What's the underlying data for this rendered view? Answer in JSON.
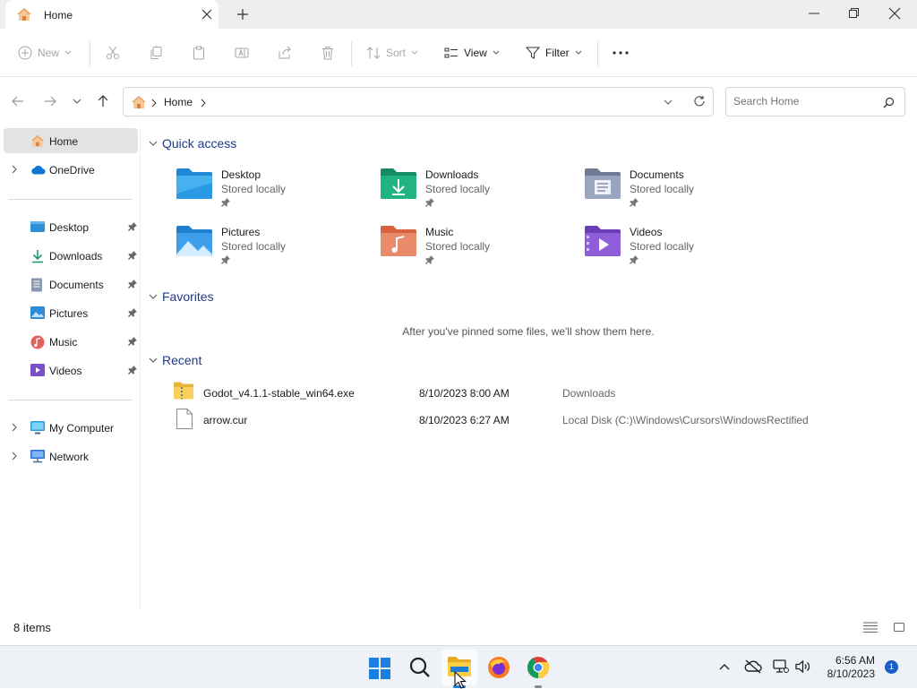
{
  "window": {
    "tab_title": "Home"
  },
  "toolbar": {
    "new_label": "New",
    "sort_label": "Sort",
    "view_label": "View",
    "filter_label": "Filter"
  },
  "address": {
    "crumb": "Home"
  },
  "search": {
    "placeholder": "Search Home"
  },
  "sidebar": {
    "top": [
      {
        "label": "Home"
      },
      {
        "label": "OneDrive"
      }
    ],
    "pinned": [
      {
        "label": "Desktop"
      },
      {
        "label": "Downloads"
      },
      {
        "label": "Documents"
      },
      {
        "label": "Pictures"
      },
      {
        "label": "Music"
      },
      {
        "label": "Videos"
      }
    ],
    "bottom": [
      {
        "label": "My Computer"
      },
      {
        "label": "Network"
      }
    ]
  },
  "main": {
    "quick_access_title": "Quick access",
    "quick_access": [
      {
        "name": "Desktop",
        "sub": "Stored locally"
      },
      {
        "name": "Downloads",
        "sub": "Stored locally"
      },
      {
        "name": "Documents",
        "sub": "Stored locally"
      },
      {
        "name": "Pictures",
        "sub": "Stored locally"
      },
      {
        "name": "Music",
        "sub": "Stored locally"
      },
      {
        "name": "Videos",
        "sub": "Stored locally"
      }
    ],
    "favorites_title": "Favorites",
    "favorites_empty": "After you've pinned some files, we'll show them here.",
    "recent_title": "Recent",
    "recent": [
      {
        "name": "Godot_v4.1.1-stable_win64.exe",
        "date": "8/10/2023 8:00 AM",
        "location": "Downloads"
      },
      {
        "name": "arrow.cur",
        "date": "8/10/2023 6:27 AM",
        "location": "Local Disk (C:)\\Windows\\Cursors\\WindowsRectified"
      }
    ]
  },
  "status": {
    "items_count": "8 items"
  },
  "taskbar": {
    "time": "6:56 AM",
    "date": "8/10/2023",
    "notification_count": "1"
  },
  "colors": {
    "accent": "#0067c0",
    "section_header": "#1f3a8a",
    "selection": "#e3e3e3"
  }
}
